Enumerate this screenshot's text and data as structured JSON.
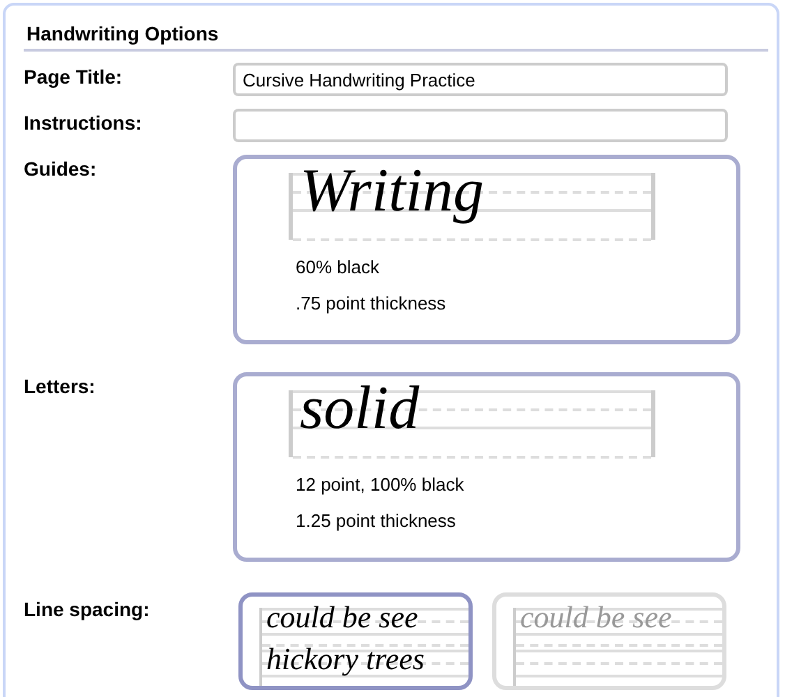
{
  "section": {
    "title": "Handwriting Options"
  },
  "fields": [
    {
      "label": "Page Title:",
      "value": "Cursive Handwriting Practice"
    },
    {
      "label": "Instructions:"
    }
  ],
  "options": [
    {
      "label": "Guides:",
      "sample": "Writing",
      "notes": [
        "60% black",
        ".75 point thickness"
      ]
    },
    {
      "label": "Letters:",
      "sample": "solid",
      "notes": [
        "12 point, 100% black",
        "1.25 point thickness"
      ]
    }
  ],
  "line_spacing": {
    "label": "Line spacing:",
    "choices": [
      {
        "samples": [
          "could be see",
          "hickory trees"
        ],
        "selected": true
      },
      {
        "samples": [
          "could be see"
        ],
        "selected": false
      }
    ]
  }
}
